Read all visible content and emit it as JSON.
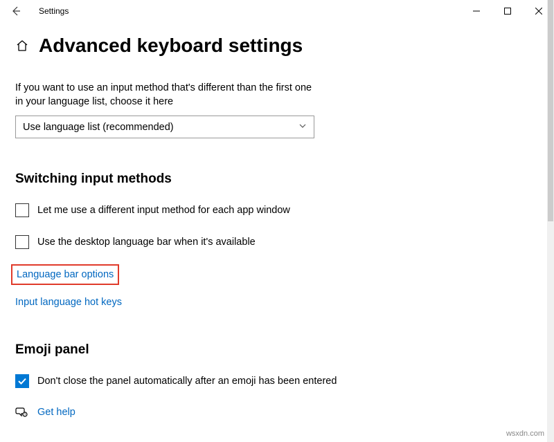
{
  "titlebar": {
    "title": "Settings"
  },
  "page": {
    "heading": "Advanced keyboard settings",
    "description": "If you want to use an input method that's different than the first one in your language list, choose it here",
    "select_value": "Use language list (recommended)"
  },
  "switching": {
    "heading": "Switching input methods",
    "opt_per_app": "Let me use a different input method for each app window",
    "opt_desktop_bar": "Use the desktop language bar when it's available",
    "link_langbar": "Language bar options",
    "link_hotkeys": "Input language hot keys"
  },
  "emoji": {
    "heading": "Emoji panel",
    "opt_noclose": "Don't close the panel automatically after an emoji has been entered"
  },
  "help": {
    "label": "Get help"
  },
  "watermark": "wsxdn.com"
}
